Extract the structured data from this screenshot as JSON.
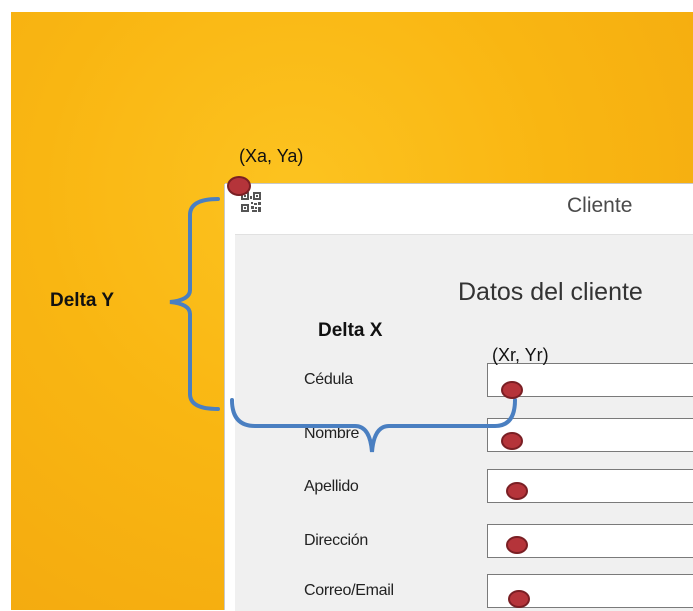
{
  "window": {
    "title": "Cliente",
    "icon": "qr-code-icon"
  },
  "form": {
    "heading": "Datos del cliente",
    "fields": [
      {
        "label": "Cédula",
        "value": ""
      },
      {
        "label": "Nombre",
        "value": ""
      },
      {
        "label": "Apellido",
        "value": ""
      },
      {
        "label": "Dirección",
        "value": ""
      },
      {
        "label": "Correo/Email",
        "value": ""
      }
    ]
  },
  "annotations": {
    "absolute_point": "(Xa, Ya)",
    "relative_point": "(Xr, Yr)",
    "delta_y": "Delta Y",
    "delta_x": "Delta X"
  },
  "colors": {
    "background": "#f9b612",
    "marker": "#b5343a",
    "bracket": "#4a7fc1",
    "window_client": "#f0f0f0"
  }
}
